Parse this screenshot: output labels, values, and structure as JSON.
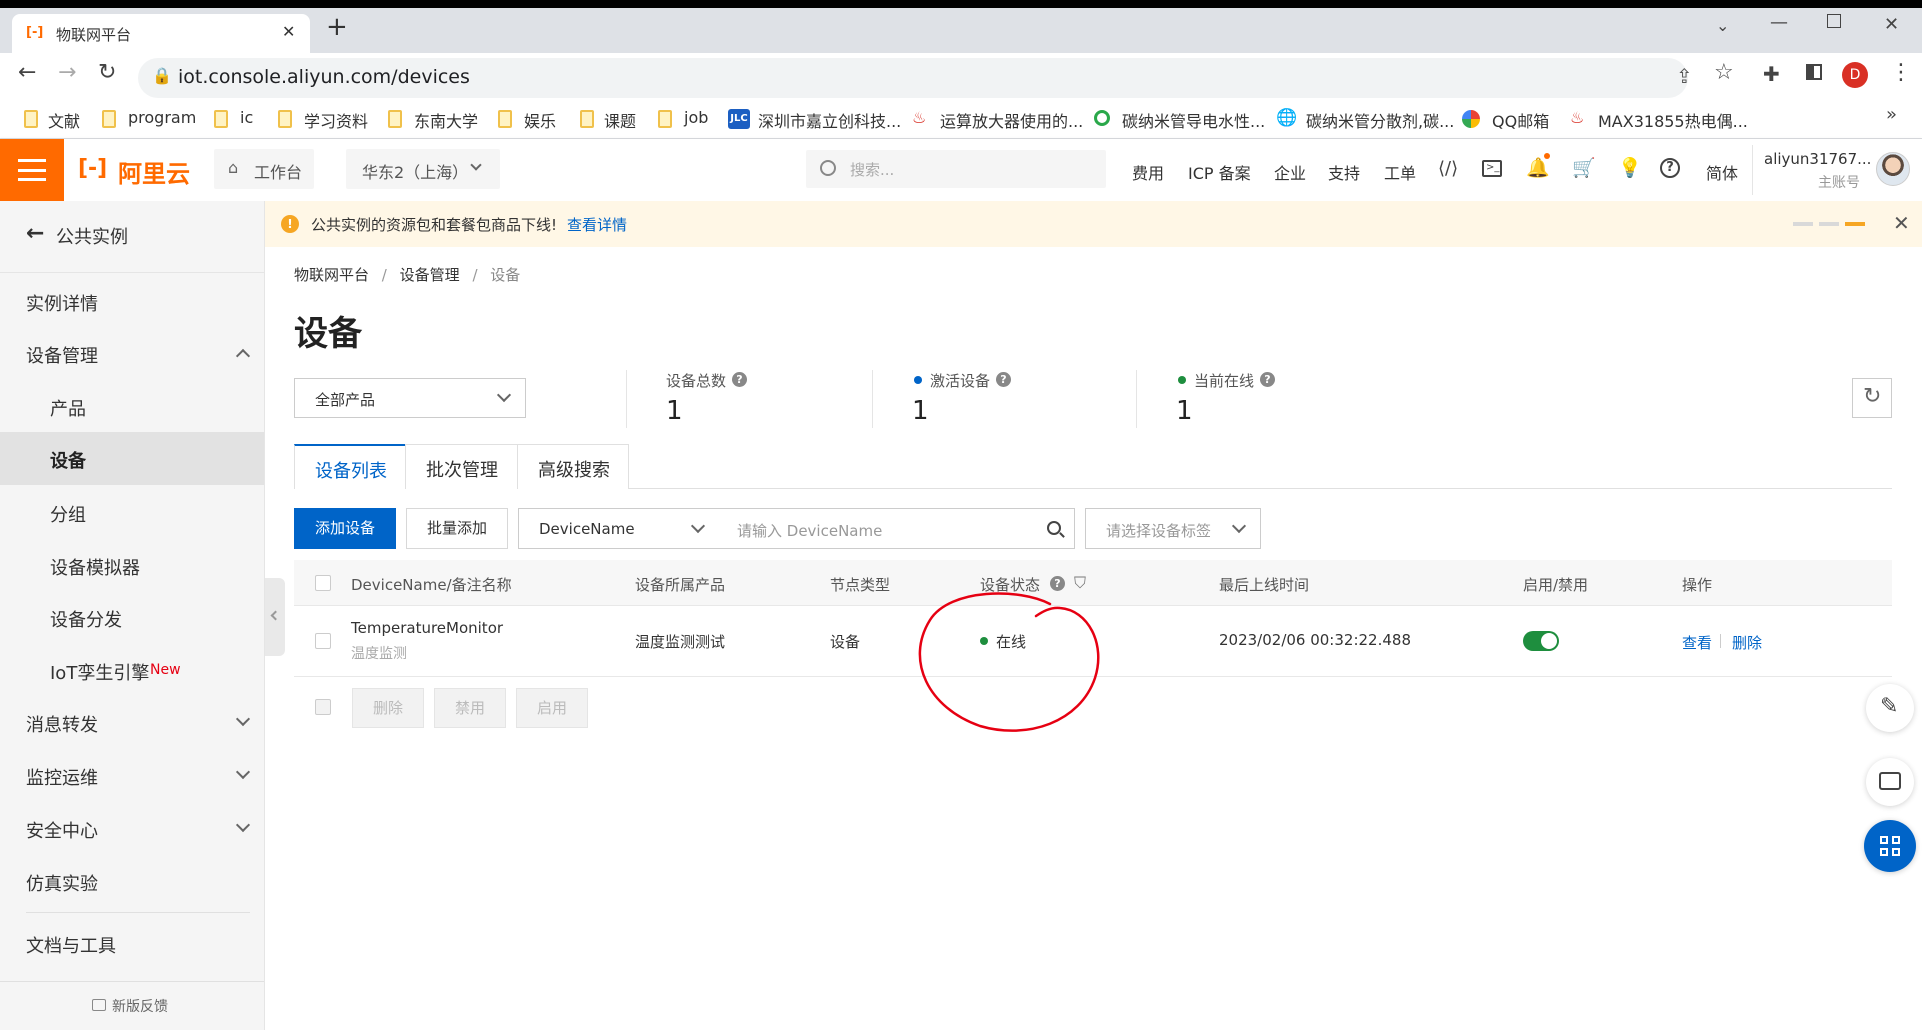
{
  "browser": {
    "tab_title": "物联网平台",
    "tab_close": "✕",
    "new_tab": "+",
    "url": "iot.console.aliyun.com/devices",
    "profile_initial": "D",
    "bookmarks": [
      "文献",
      "program",
      "ic",
      "学习资料",
      "东南大学",
      "娱乐",
      "课题",
      "job",
      "深圳市嘉立创科技...",
      "运算放大器使用的...",
      "碳纳米管导电水性...",
      "碳纳米管分散剂,碳...",
      "QQ邮箱",
      "MAX31855热电偶..."
    ],
    "bookmarks_more": "»",
    "jlc_badge": "JLC"
  },
  "header": {
    "logo_text": "阿里云",
    "workbench": "工作台",
    "region": "华东2（上海）",
    "search_placeholder": "搜索...",
    "links": [
      "费用",
      "ICP 备案",
      "企业",
      "支持",
      "工单"
    ],
    "lang": "简体",
    "username": "aliyun31767...",
    "account_type": "主账号"
  },
  "sidebar": {
    "back_label": "公共实例",
    "items": {
      "instance_detail": "实例详情",
      "device_mgmt": "设备管理",
      "product": "产品",
      "device": "设备",
      "group": "分组",
      "simulator": "设备模拟器",
      "distribution": "设备分发",
      "twin": "IoT孪生引擎",
      "twin_badge": "New",
      "message": "消息转发",
      "monitor": "监控运维",
      "security": "安全中心",
      "simulation": "仿真实验",
      "docs": "文档与工具",
      "feedback": "新版反馈"
    }
  },
  "notice": {
    "text": "公共实例的资源包和套餐包商品下线!",
    "link": "查看详情"
  },
  "breadcrumb": [
    "物联网平台",
    "设备管理",
    "设备"
  ],
  "page_title": "设备",
  "product_select": "全部产品",
  "stats": [
    {
      "label": "设备总数",
      "value": "1"
    },
    {
      "label": "激活设备",
      "value": "1"
    },
    {
      "label": "当前在线",
      "value": "1"
    }
  ],
  "tabs": [
    "设备列表",
    "批次管理",
    "高级搜索"
  ],
  "toolbar": {
    "add_device": "添加设备",
    "batch_add": "批量添加",
    "search_field": "DeviceName",
    "search_placeholder": "请输入 DeviceName",
    "tag_placeholder": "请选择设备标签"
  },
  "table": {
    "headers": [
      "DeviceName/备注名称",
      "设备所属产品",
      "节点类型",
      "设备状态",
      "最后上线时间",
      "启用/禁用",
      "操作"
    ],
    "rows": [
      {
        "name": "TemperatureMonitor",
        "note": "温度监测",
        "product": "温度监测测试",
        "node_type": "设备",
        "status": "在线",
        "last_online": "2023/02/06 00:32:22.488",
        "enabled": true,
        "actions": [
          "查看",
          "删除"
        ]
      }
    ],
    "bulk_actions": [
      "删除",
      "禁用",
      "启用"
    ]
  },
  "colors": {
    "brand": "#ff6a00",
    "primary": "#0064c8",
    "online": "#1e8e3e",
    "annotation": "#e60012"
  }
}
